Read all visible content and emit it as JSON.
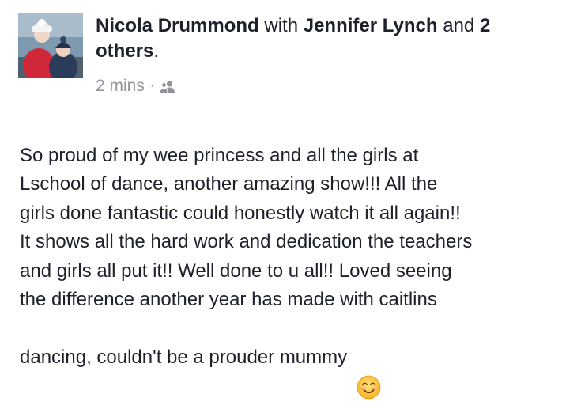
{
  "post": {
    "author": "Nicola Drummond",
    "with_word": "with",
    "tagged_person": "Jennifer Lynch",
    "and_word": "and",
    "others_count": "2",
    "others_word": "others",
    "period": ".",
    "timestamp": "2 mins",
    "separator": "·",
    "audience_icon": "friends-icon",
    "text_lines": "So proud of my wee princess and all the girls at\nLschool of dance, another amazing show!!! All the\ngirls done fantastic could honestly watch it all again!!\nIt shows all the hard work and dedication the teachers\nand girls all put it!! Well done to u all!! Loved seeing\nthe difference another year has made with caitlins",
    "last_line": "dancing, couldn't be a prouder mummy",
    "emoji": "smiling-face-emoji"
  }
}
